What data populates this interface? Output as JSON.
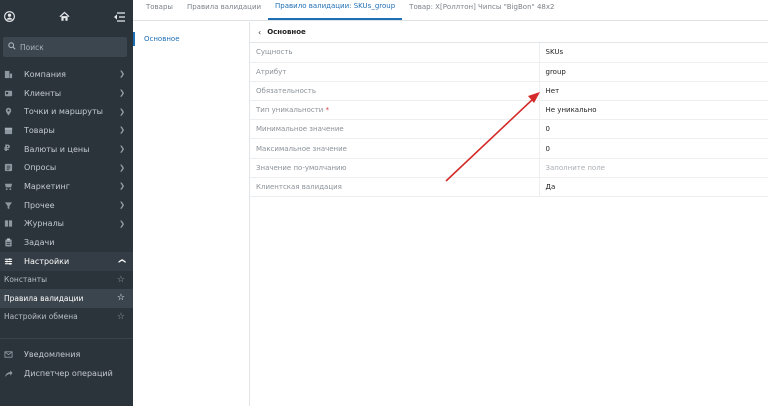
{
  "sidebar": {
    "search_placeholder": "Поиск",
    "nav": [
      {
        "label": "Компания",
        "icon": "building-icon"
      },
      {
        "label": "Клиенты",
        "icon": "clients-icon"
      },
      {
        "label": "Точки и маршруты",
        "icon": "map-pin-icon"
      },
      {
        "label": "Товары",
        "icon": "box-icon"
      },
      {
        "label": "Валюты и цены",
        "icon": "ruble-icon"
      },
      {
        "label": "Опросы",
        "icon": "survey-icon"
      },
      {
        "label": "Маркетинг",
        "icon": "marketing-icon"
      },
      {
        "label": "Прочее",
        "icon": "filter-icon"
      },
      {
        "label": "Журналы",
        "icon": "journal-icon"
      },
      {
        "label": "Задачи",
        "icon": "clipboard-icon"
      },
      {
        "label": "Настройки",
        "icon": "sliders-icon"
      }
    ],
    "sub": [
      {
        "label": "Константы"
      },
      {
        "label": "Правила валидации"
      },
      {
        "label": "Настройки обмена"
      }
    ],
    "bottom": [
      {
        "label": "Уведомления"
      },
      {
        "label": "Диспетчер операций"
      }
    ]
  },
  "tabs": [
    {
      "label": "Товары"
    },
    {
      "label": "Правила валидации"
    },
    {
      "label": "Правило валидации: SKUs_group"
    },
    {
      "label": "Товар: Х[Роллтон] Чипсы \"BigBon\" 48x2"
    }
  ],
  "section": {
    "label": "Основное"
  },
  "group": {
    "title": "Основное"
  },
  "fields": [
    {
      "label": "Сущность",
      "value": "SKUs"
    },
    {
      "label": "Атрибут",
      "value": "group"
    },
    {
      "label": "Обязательность",
      "value": "Нет"
    },
    {
      "label": "Тип уникальности",
      "required_mark": "*",
      "value": "Не уникально"
    },
    {
      "label": "Минимальное значение",
      "value": "0"
    },
    {
      "label": "Максимальное значение",
      "value": "0"
    },
    {
      "label": "Значение по-умолчанию",
      "placeholder": "Заполните поле"
    },
    {
      "label": "Клиентская валидация",
      "value": "Да"
    }
  ],
  "colors": {
    "sidebar_bg": "#2b333b",
    "accent": "#1f6fb5",
    "annotation_arrow": "#d42a2a"
  }
}
